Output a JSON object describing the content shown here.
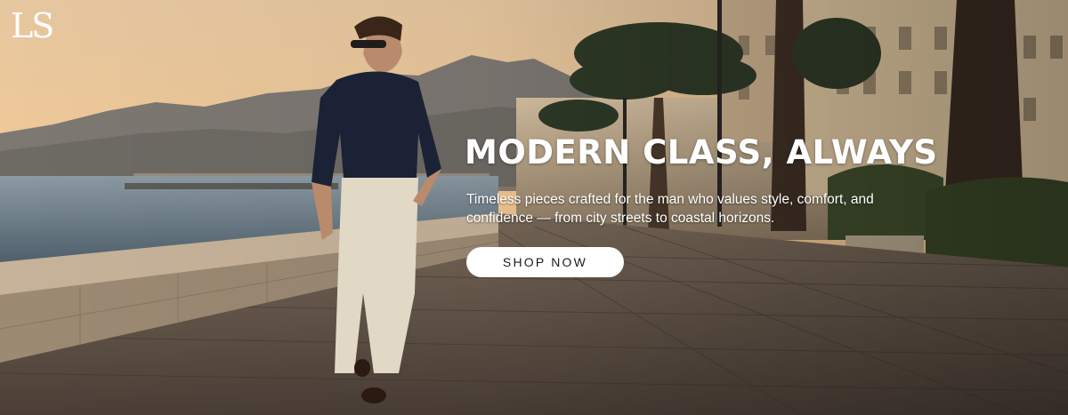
{
  "brand": {
    "logo_text": "LS"
  },
  "hero": {
    "headline": "MODERN CLASS, ALWAYS",
    "subtext": "Timeless pieces crafted for the man who values style, comfort, and confidence — from city streets to coastal horizons.",
    "cta_label": "SHOP NOW"
  },
  "colors": {
    "text": "#ffffff",
    "button_bg": "#ffffff",
    "button_text": "#1b1b1b"
  }
}
